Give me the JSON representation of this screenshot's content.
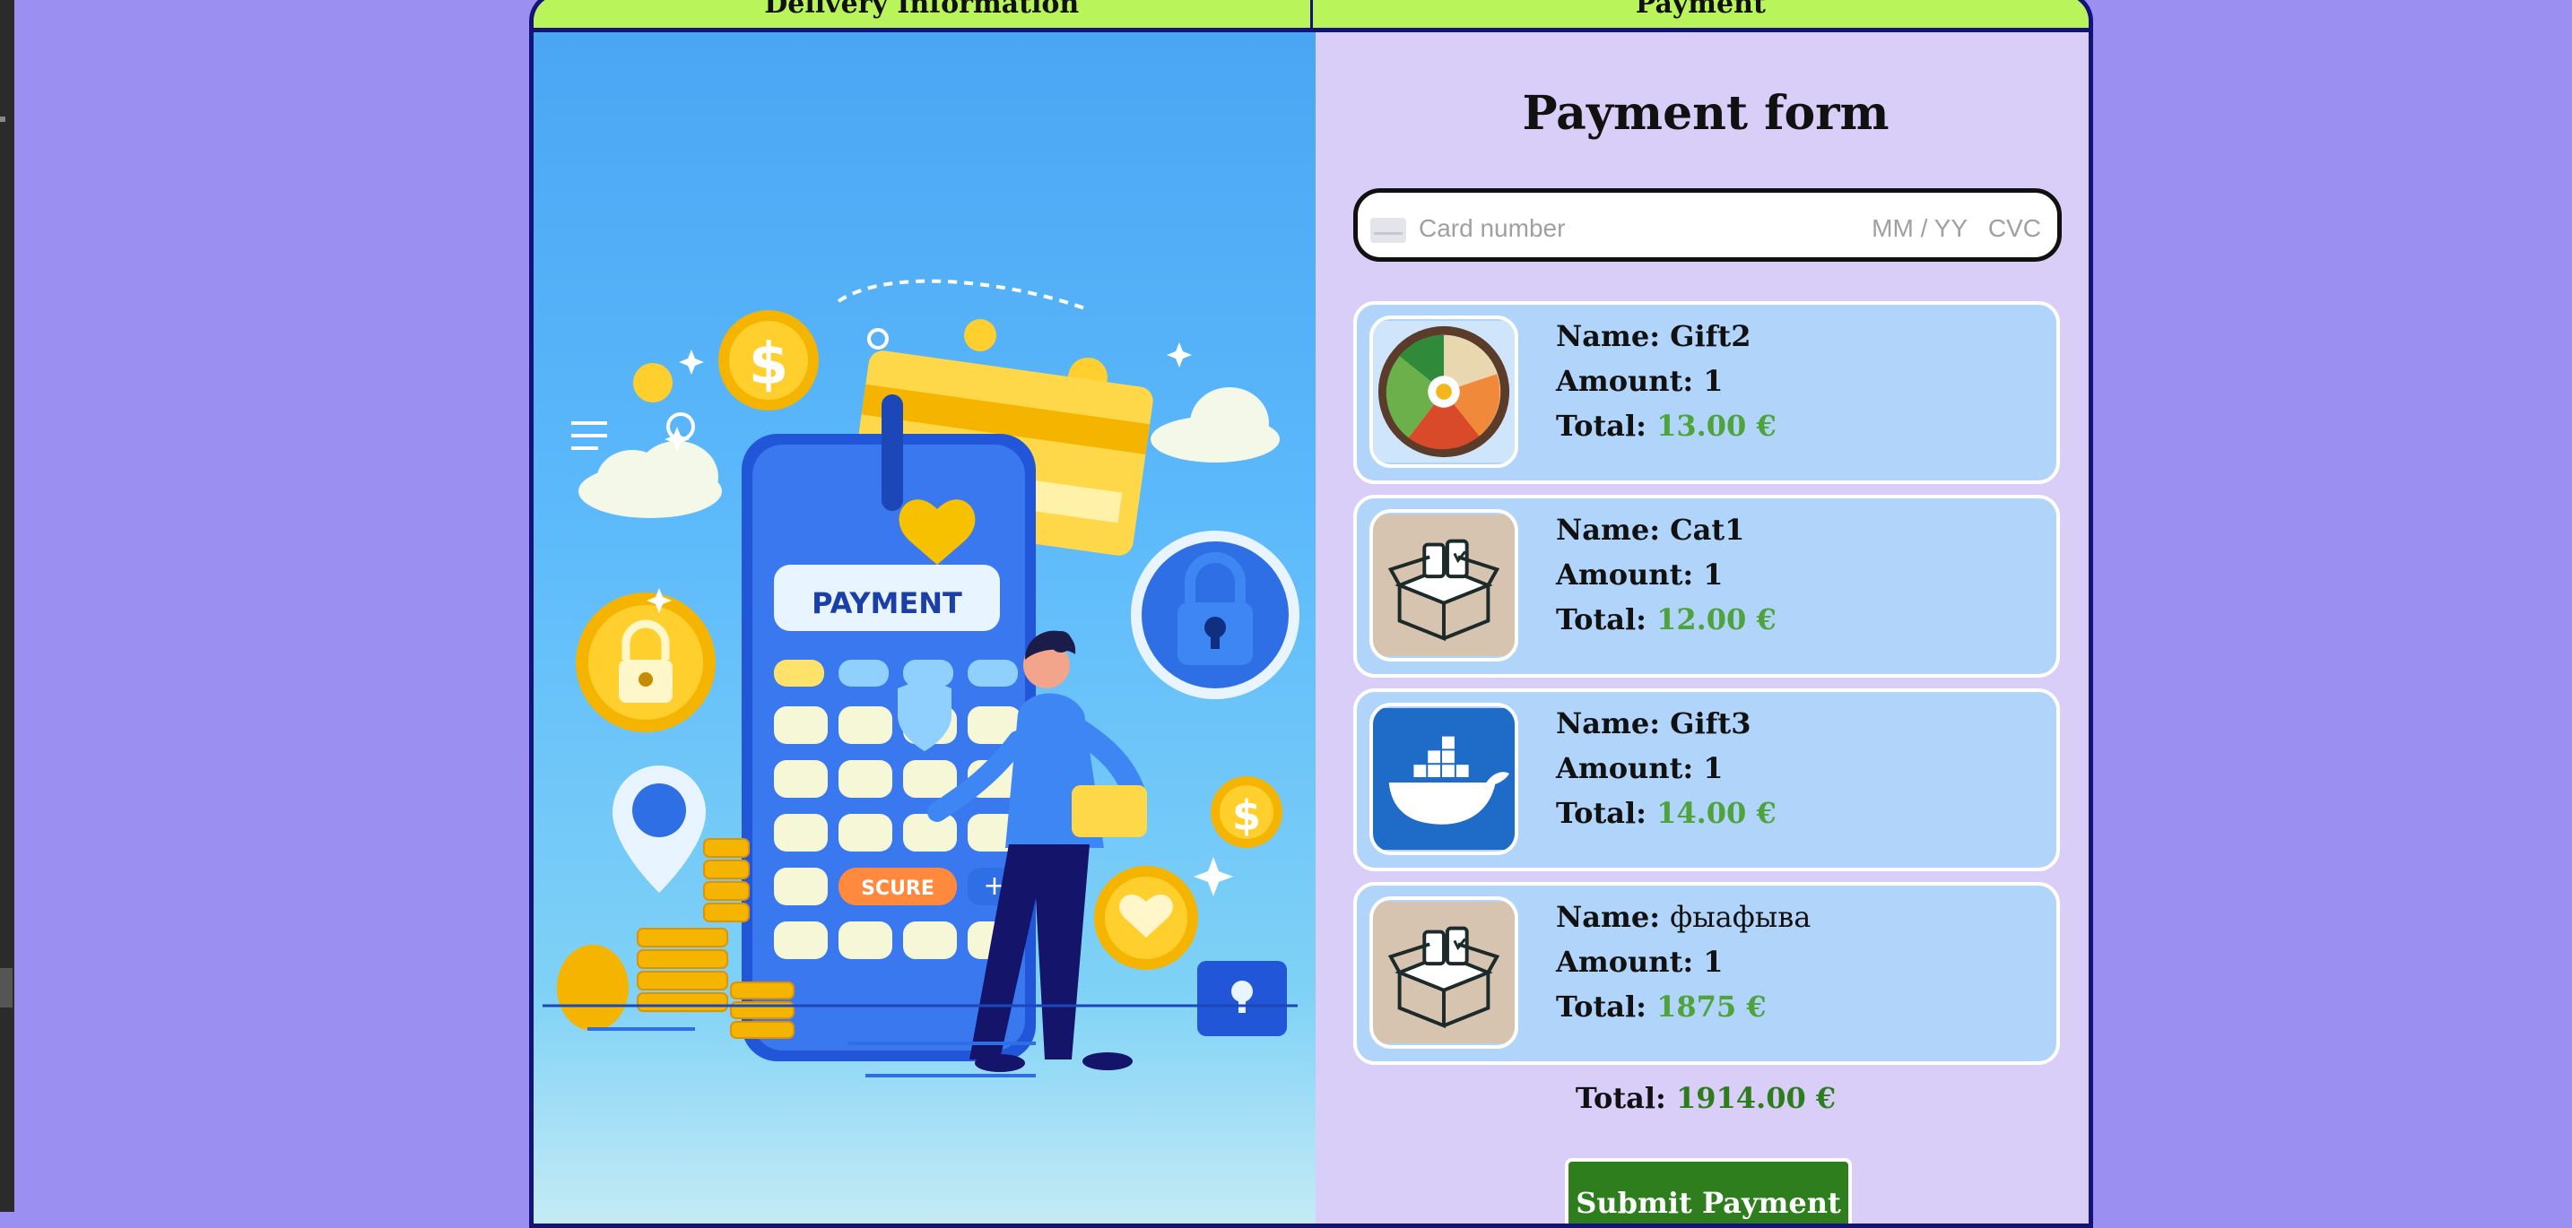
{
  "tabs": {
    "delivery": "Delivery Information",
    "payment": "Payment"
  },
  "illustration": {
    "payment_label": "PAYMENT",
    "secure_label": "SCURE"
  },
  "form": {
    "title": "Payment form",
    "card_number_placeholder": "Card number",
    "expiry_placeholder": "MM / YY",
    "cvc_placeholder": "CVC"
  },
  "labels": {
    "name": "Name:",
    "amount": "Amount:",
    "total": "Total:"
  },
  "items": [
    {
      "name": "Gift2",
      "amount": "1",
      "total": "13.00 €",
      "image": "food-bowl-image"
    },
    {
      "name": "Cat1",
      "amount": "1",
      "total": "12.00 €",
      "image": "gift-box-image"
    },
    {
      "name": "Gift3",
      "amount": "1",
      "total": "14.00 €",
      "image": "docker-whale-image"
    },
    {
      "name": "фыафыва",
      "amount": "1",
      "total": "1875 €",
      "image": "gift-box-image"
    }
  ],
  "summary": {
    "total_label": "Total:",
    "total_value": "1914.00 €"
  },
  "submit_label": "Submit Payment",
  "colors": {
    "background": "#9b8ff2",
    "tab_bar": "#b9f55a",
    "frame_border": "#13137a",
    "item_card": "#b1d4fa",
    "price_green": "#4ea33c",
    "submit_button": "#2f7e1e"
  }
}
